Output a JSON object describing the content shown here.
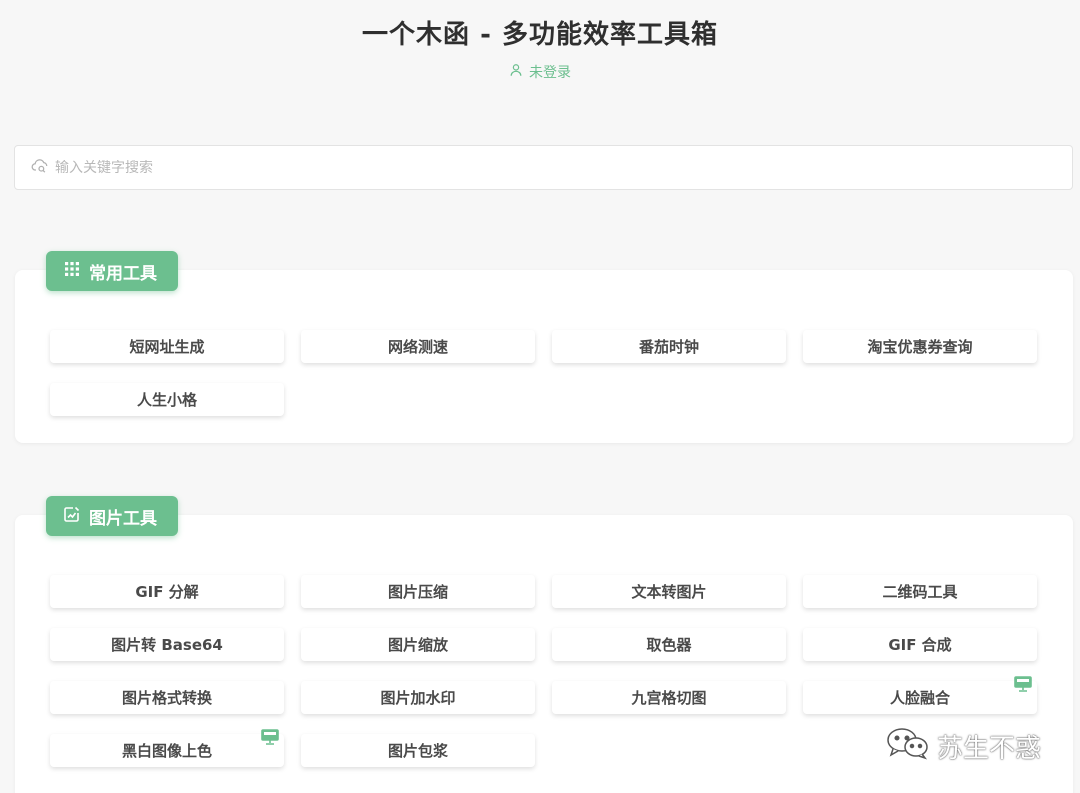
{
  "header": {
    "title": "一个木函 - 多功能效率工具箱",
    "login_status": "未登录"
  },
  "search": {
    "placeholder": "输入关键字搜索"
  },
  "categories": [
    {
      "label": "常用工具",
      "icon": "grid-icon",
      "tools": [
        {
          "label": "短网址生成"
        },
        {
          "label": "网络测速"
        },
        {
          "label": "番茄时钟"
        },
        {
          "label": "淘宝优惠券查询"
        },
        {
          "label": "人生小格"
        }
      ]
    },
    {
      "label": "图片工具",
      "icon": "image-edit-icon",
      "tools": [
        {
          "label": "GIF 分解"
        },
        {
          "label": "图片压缩"
        },
        {
          "label": "文本转图片"
        },
        {
          "label": "二维码工具"
        },
        {
          "label": "图片转 Base64"
        },
        {
          "label": "图片缩放"
        },
        {
          "label": "取色器"
        },
        {
          "label": "GIF 合成"
        },
        {
          "label": "图片格式转换"
        },
        {
          "label": "图片加水印"
        },
        {
          "label": "九宫格切图"
        },
        {
          "label": "人脸融合",
          "badge": "desktop-icon"
        },
        {
          "label": "黑白图像上色",
          "badge": "desktop-icon"
        },
        {
          "label": "图片包浆"
        }
      ]
    }
  ],
  "watermark": {
    "text": "苏生不惑",
    "icon": "wechat-icon"
  },
  "colors": {
    "accent": "#6cbf8f",
    "background": "#f7f7f7",
    "card": "#ffffff"
  }
}
